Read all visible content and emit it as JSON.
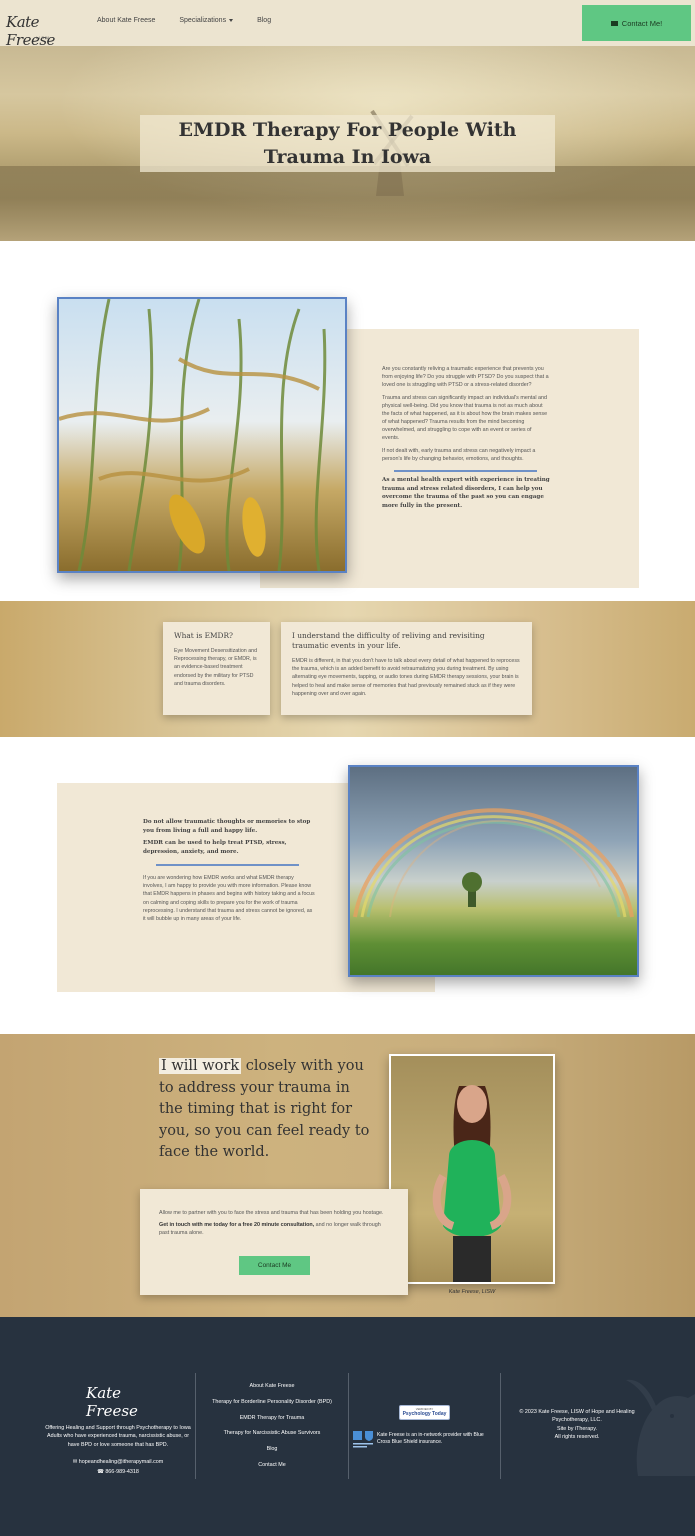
{
  "nav": {
    "logo": "Kate Freese",
    "logo_sub": "LISW",
    "links": [
      {
        "label": "About Kate Freese"
      },
      {
        "label": "Specializations"
      },
      {
        "label": "Blog"
      }
    ],
    "contact_label": "Contact Me!"
  },
  "hero": {
    "title": "EMDR Therapy For People With Trauma In Iowa"
  },
  "intro": {
    "paragraphs": [
      "Are you constantly reliving a traumatic experience that prevents you from enjoying life? Do you struggle with PTSD? Do you suspect that a loved one is struggling with PTSD or a stress-related disorder?",
      "Trauma and stress can significantly impact an individual's mental and physical well-being. Did you know that trauma is not as much about the facts of what happened, as it is about how the brain makes sense of what happened? Trauma results from the mind becoming overwhelmed, and struggling to cope with an event or series of events.",
      "If not dealt with, early trauma and stress can negatively impact a person's life by changing behavior, emotions, and thoughts."
    ],
    "bold": "As a mental health expert with experience in treating trauma and stress related disorders, I can help you overcome the trauma of the past so you can engage more fully in the present."
  },
  "cards": {
    "small": {
      "title": "What is EMDR?",
      "text": "Eye Movement Desensitization and Reprocessing therapy, or EMDR, is an evidence-based treatment endorsed by the military for PTSD and trauma disorders."
    },
    "big": {
      "title": "I understand the difficulty of reliving and revisiting traumatic events in your life.",
      "text": "EMDR is different, in that you don't have to talk about every detail of what happened to reprocess the trauma, which is an added benefit to avoid retraumatizing you during treatment. By using alternating eye movements, tapping, or audio tones during EMDR therapy sessions, your brain is helped to heal and make sense of memories that had previously remained stuck as if they were happening over and over again."
    }
  },
  "section3": {
    "bold1": "Do not allow traumatic thoughts or memories to stop you from living a full and happy life.",
    "bold2": "EMDR can be used to help treat PTSD, stress, depression, anxiety, and more.",
    "text": "If you are wondering how EMDR works and what EMDR therapy involves, I am happy to provide you with more information. Please know that EMDR happens in phases and begins with history taking and a focus on calming and coping skills to prepare you for the work of trauma reprocessing. I understand that trauma and stress cannot be ignored, as it will bubble up in many areas of your life."
  },
  "section4": {
    "quote_highlight": "I will work",
    "quote_rest": " closely with you to address your trauma in the timing that is right for you, so you can feel ready to face the world.",
    "card_p1": "Allow me to partner with you to face the stress and trauma that has been holding you hostage.",
    "card_bold": "Get in touch with me today for a free 20 minute consultation,",
    "card_rest": " and no longer walk through past trauma alone.",
    "button": "Contact Me",
    "caption": "Kate Freese, LISW"
  },
  "footer": {
    "logo": "Kate Freese",
    "tagline": "Offering Healing and Support through Psychotherapy to Iowa Adults who have experienced trauma, narcissistic abuse, or have BPD or love someone that has BPD.",
    "email": "hopeandhealing@itherapymail.com",
    "phone": "866-989-4318",
    "links": [
      "About Kate Freese",
      "Therapy for Borderline Personality Disorder (BPD)",
      "EMDR Therapy for Trauma",
      "Therapy for Narcissistic Abuse Survivors",
      "Blog",
      "Contact Me"
    ],
    "pt_small": "VERIFIED BY",
    "pt_big": "Psychology Today",
    "bcbs": "Kate Freese is an in-network provider with Blue Cross Blue Shield insurance.",
    "copyright": "© 2023 Kate Freese, LISW of Hope and Healing Psychotherapy, LLC.",
    "site_by": "Site by iTherapy.",
    "rights": "All rights reserved."
  },
  "colors": {
    "accent_green": "#5fc783",
    "rule_blue": "#6f91c7",
    "card_beige": "#f1e8d6",
    "footer_navy": "#27323f"
  }
}
